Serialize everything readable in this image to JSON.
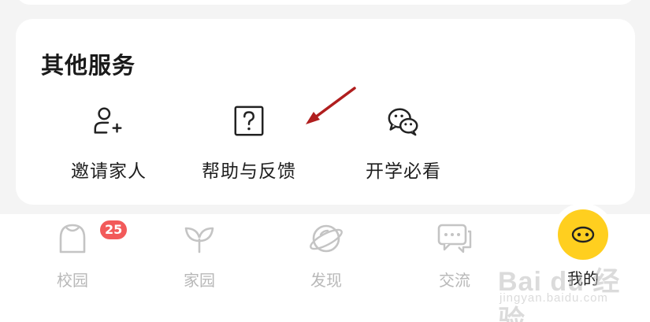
{
  "services": {
    "title": "其他服务",
    "items": [
      {
        "label": "邀请家人",
        "icon": "add-person-icon"
      },
      {
        "label": "帮助与反馈",
        "icon": "help-question-icon"
      },
      {
        "label": "开学必看",
        "icon": "wechat-icon"
      }
    ]
  },
  "tabbar": {
    "tabs": [
      {
        "label": "校园",
        "icon": "campus-icon",
        "badge": "25"
      },
      {
        "label": "家园",
        "icon": "leaf-icon"
      },
      {
        "label": "发现",
        "icon": "planet-icon"
      },
      {
        "label": "交流",
        "icon": "chat-icon"
      },
      {
        "label": "我的",
        "icon": "smiley-face-icon",
        "active": true
      }
    ]
  },
  "watermark": {
    "main": "Bai du 经验",
    "sub": "jingyan.baidu.com"
  },
  "colors": {
    "badge": "#f25a5a",
    "accent_yellow": "#ffcf1f",
    "annotation_arrow": "#b01e1e",
    "inactive_tab": "#b8b8b8"
  }
}
